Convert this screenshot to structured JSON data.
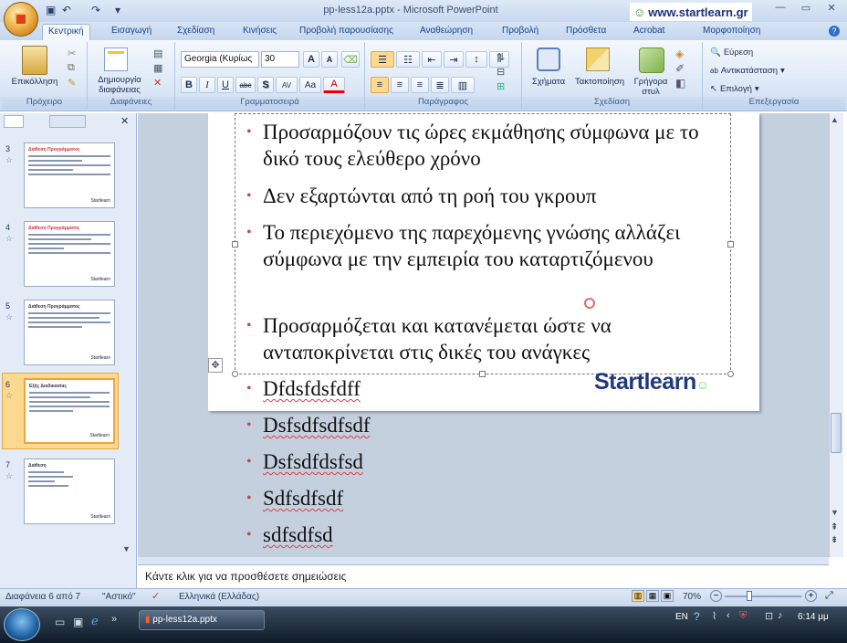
{
  "window": {
    "title": "pp-less12a.pptx - Microsoft PowerPoint",
    "brand": "www.startlearn.gr"
  },
  "qat": {
    "undo": "↶",
    "redo": "↷",
    "save": "▣",
    "more": "▾"
  },
  "tabs": [
    "Κεντρική",
    "Εισαγωγή",
    "Σχεδίαση",
    "Κινήσεις",
    "Προβολή παρουσίασης",
    "Αναθεώρηση",
    "Προβολή",
    "Πρόσθετα",
    "Acrobat",
    "Μορφοποίηση"
  ],
  "ribbon": {
    "clipboard": {
      "paste": "Επικόλληση",
      "label": "Πρόχειρο"
    },
    "slides": {
      "new_slide": "Δημιουργία διαφάνειας",
      "label": "Διαφάνειες"
    },
    "font": {
      "name": "Georgia (Κυρίως",
      "size": "30",
      "label": "Γραμματοσειρά",
      "bold": "B",
      "italic": "I",
      "underline": "U",
      "strike": "abc",
      "shadow": "S",
      "spacing": "AV",
      "case": "Aa",
      "color": "A",
      "grow": "A",
      "shrink": "A"
    },
    "paragraph": {
      "label": "Παράγραφος"
    },
    "drawing": {
      "shapes": "Σχήματα",
      "arrange": "Τακτοποίηση",
      "quick_styles": "Γρήγορα στυλ",
      "label": "Σχεδίαση"
    },
    "editing": {
      "find": "Εύρεση",
      "replace": "Αντικατάσταση",
      "select": "Επιλογή",
      "label": "Επεξεργασία"
    }
  },
  "thumbnails": [
    {
      "num": "3",
      "title": "Διάθεση Προγράμματος"
    },
    {
      "num": "4",
      "title": "Διάθεση Προγράμματος"
    },
    {
      "num": "5",
      "title": "Διάθεση Προγράμματος"
    },
    {
      "num": "6",
      "title": "Εξής Διαδικασίας"
    },
    {
      "num": "7",
      "title": "Διάθεση"
    }
  ],
  "slide": {
    "bullets": [
      "Προσαρμόζουν τις ώρες εκμάθησης σύμφωνα με το δικό τους ελεύθερο χρόνο",
      "Δεν εξαρτώνται από τη ροή του γκρουπ",
      "Το περιεχόμενο της παρεχόμενης γνώσης αλλάζει σύμφωνα με την εμπειρία του καταρτιζόμενου",
      "Προσαρμόζεται και κατανέμεται ώστε να ανταποκρίνεται στις δικές του ανάγκες",
      "Dfdsfdsfdff"
    ],
    "overflow": [
      "Dsfsdfsdfsdf",
      "Dsfsdfdsfsd",
      "Sdfsdfsdf",
      "sdfsdfsd"
    ],
    "logo": "Startlearn"
  },
  "notes_placeholder": "Κάντε κλικ για να προσθέσετε σημειώσεις",
  "status": {
    "slide_pos": "Διαφάνεια 6 από 7",
    "theme": "\"Αστικό\"",
    "language": "Ελληνικά (Ελλάδας)",
    "zoom": "70%"
  },
  "taskbar": {
    "app": "pp-less12a.pptx",
    "lang": "EN",
    "time": "6:14 μμ"
  }
}
